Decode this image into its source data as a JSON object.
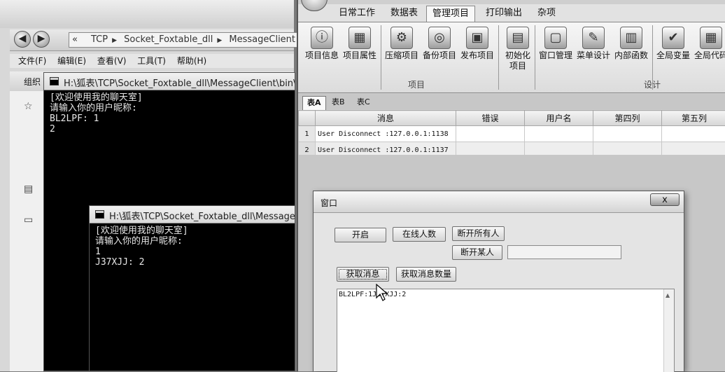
{
  "explorer": {
    "back_icon": "back-arrow-icon",
    "forward_icon": "forward-arrow-icon",
    "breadcrumb": [
      "TCP",
      "Socket_Foxtable_dll",
      "MessageClient"
    ],
    "overflow_label": "«",
    "menus": [
      "文件(F)",
      "编辑(E)",
      "查看(V)",
      "工具(T)",
      "帮助(H)"
    ],
    "organize_label": "组织"
  },
  "console1": {
    "title": "H:\\狐表\\TCP\\Socket_Foxtable_dll\\MessageClient\\bin\\Deb",
    "output": "[欢迎使用我的聊天室]\n请输入你的用户昵称:\nBL2LPF: 1\n2"
  },
  "console2": {
    "title": "H:\\狐表\\TCP\\Socket_Foxtable_dll\\MessageClie",
    "output": "[欢迎使用我的聊天室]\n请输入你的用户昵称:\n1\nJ37XJJ: 2"
  },
  "app": {
    "ribbon_tabs": [
      "日常工作",
      "数据表",
      "管理项目",
      "打印输出",
      "杂项"
    ],
    "active_tab": "管理项目",
    "groups": [
      {
        "label": "项目",
        "buttons": [
          "项目信息",
          "项目属性",
          "压缩项目",
          "备份项目",
          "发布项目",
          "初始化\n项目"
        ]
      },
      {
        "label": "设计",
        "buttons": [
          "窗口管理",
          "菜单设计",
          "内部函数",
          "全局变量",
          "全局代码"
        ]
      }
    ],
    "sheet_tabs": [
      "表A",
      "表B",
      "表C"
    ],
    "grid": {
      "columns": [
        "消息",
        "错误",
        "用户名",
        "第四列",
        "第五列"
      ],
      "rows": [
        {
          "num": "1",
          "cells": [
            "User Disconnect :127.0.0.1:1138",
            "",
            "",
            "",
            ""
          ]
        },
        {
          "num": "2",
          "cells": [
            "User Disconnect :127.0.0.1:1137",
            "",
            "",
            "",
            ""
          ]
        }
      ]
    }
  },
  "dialog": {
    "title": "窗口",
    "close_label": "x",
    "buttons": {
      "start": "开启",
      "online_count": "在线人数",
      "disconnect_all": "断开所有人",
      "disconnect_one": "断开某人",
      "get_messages": "获取消息",
      "get_message_count": "获取消息数量"
    },
    "name_input_value": "",
    "message_text": "BL2LPF:1J37XJJ:2"
  }
}
